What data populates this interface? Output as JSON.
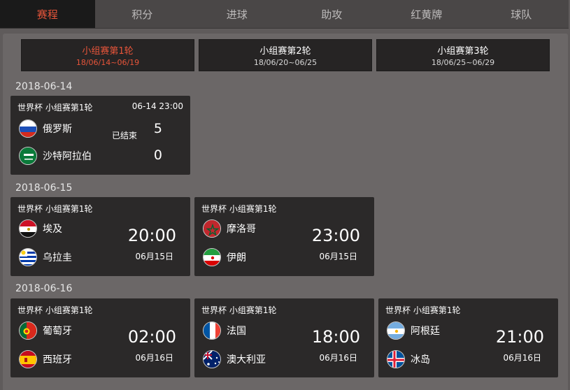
{
  "tabs": [
    {
      "label": "赛程",
      "active": true
    },
    {
      "label": "积分",
      "active": false
    },
    {
      "label": "进球",
      "active": false
    },
    {
      "label": "助攻",
      "active": false
    },
    {
      "label": "红黄牌",
      "active": false
    },
    {
      "label": "球队",
      "active": false
    }
  ],
  "colors": {
    "accent": "#e8553a",
    "card_bg": "#2b2929",
    "panel_bg": "#6b6767"
  },
  "rounds": [
    {
      "name": "小组赛第1轮",
      "dates": "18/06/14~06/19",
      "active": true
    },
    {
      "name": "小组赛第2轮",
      "dates": "18/06/20~06/25",
      "active": false
    },
    {
      "name": "小组赛第3轮",
      "dates": "18/06/25~06/29",
      "active": false
    }
  ],
  "days": [
    {
      "date": "2018-06-14",
      "matches": [
        {
          "competition": "世界杯 小组赛第1轮",
          "kickoff": "06-14 23:00",
          "status": "已结束",
          "home": {
            "name": "俄罗斯",
            "flag": "russia-flag",
            "score": "5"
          },
          "away": {
            "name": "沙特阿拉伯",
            "flag": "saudi-arabia-flag",
            "score": "0"
          }
        }
      ]
    },
    {
      "date": "2018-06-15",
      "matches": [
        {
          "competition": "世界杯 小组赛第1轮",
          "time": "20:00",
          "day": "06月15日",
          "home": {
            "name": "埃及",
            "flag": "egypt-flag"
          },
          "away": {
            "name": "乌拉圭",
            "flag": "uruguay-flag"
          }
        },
        {
          "competition": "世界杯 小组赛第1轮",
          "time": "23:00",
          "day": "06月15日",
          "home": {
            "name": "摩洛哥",
            "flag": "morocco-flag"
          },
          "away": {
            "name": "伊朗",
            "flag": "iran-flag"
          }
        }
      ]
    },
    {
      "date": "2018-06-16",
      "matches": [
        {
          "competition": "世界杯 小组赛第1轮",
          "time": "02:00",
          "day": "06月16日",
          "home": {
            "name": "葡萄牙",
            "flag": "portugal-flag"
          },
          "away": {
            "name": "西班牙",
            "flag": "spain-flag"
          }
        },
        {
          "competition": "世界杯 小组赛第1轮",
          "time": "18:00",
          "day": "06月16日",
          "home": {
            "name": "法国",
            "flag": "france-flag"
          },
          "away": {
            "name": "澳大利亚",
            "flag": "australia-flag"
          }
        },
        {
          "competition": "世界杯 小组赛第1轮",
          "time": "21:00",
          "day": "06月16日",
          "home": {
            "name": "阿根廷",
            "flag": "argentina-flag"
          },
          "away": {
            "name": "冰岛",
            "flag": "iceland-flag"
          }
        }
      ]
    }
  ]
}
